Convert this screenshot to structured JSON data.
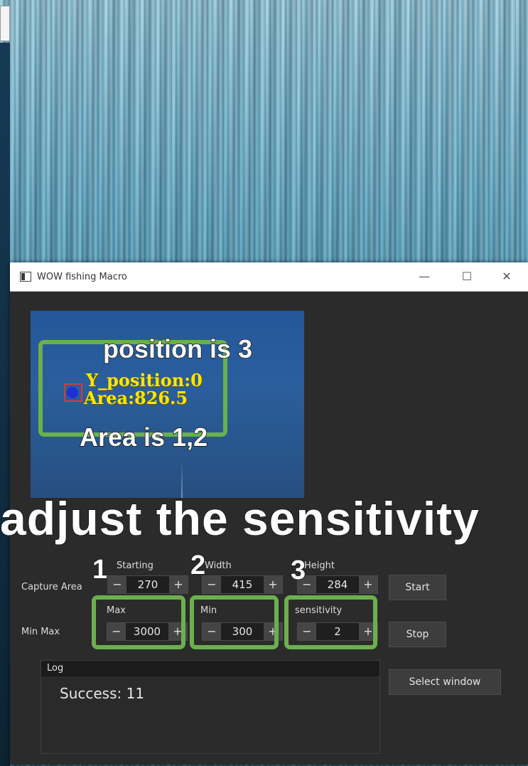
{
  "window": {
    "title": "WOW fishing Macro",
    "controls": {
      "minimize": "—",
      "maximize": "☐",
      "close": "✕"
    }
  },
  "preview": {
    "y_position_text": "Y_position:0",
    "area_text": "Area:826.5"
  },
  "annotations": {
    "position_note": "position is 3",
    "area_note": "Area is 1,2",
    "headline": "adjust the sensitivity",
    "num1": "1",
    "num2": "2",
    "num3": "3"
  },
  "capture_area": {
    "row_label": "Capture Area",
    "starting": {
      "label": "Starting",
      "value": "270"
    },
    "width": {
      "label": "Width",
      "value": "415"
    },
    "height": {
      "label": "Height",
      "value": "284"
    }
  },
  "min_max": {
    "row_label": "Min Max",
    "max": {
      "label": "Max",
      "value": "3000"
    },
    "min": {
      "label": "Min",
      "value": "300"
    },
    "sensitivity": {
      "label": "sensitivity",
      "value": "2"
    }
  },
  "spin": {
    "minus": "−",
    "plus": "+"
  },
  "buttons": {
    "start": "Start",
    "stop": "Stop",
    "select_window": "Select window"
  },
  "log": {
    "title": "Log",
    "lines": [
      "Success: 11"
    ]
  },
  "colors": {
    "annotation_box": "#6ab04c",
    "overlay_text": "#ffe600",
    "window_bg": "#2b2b2b"
  }
}
